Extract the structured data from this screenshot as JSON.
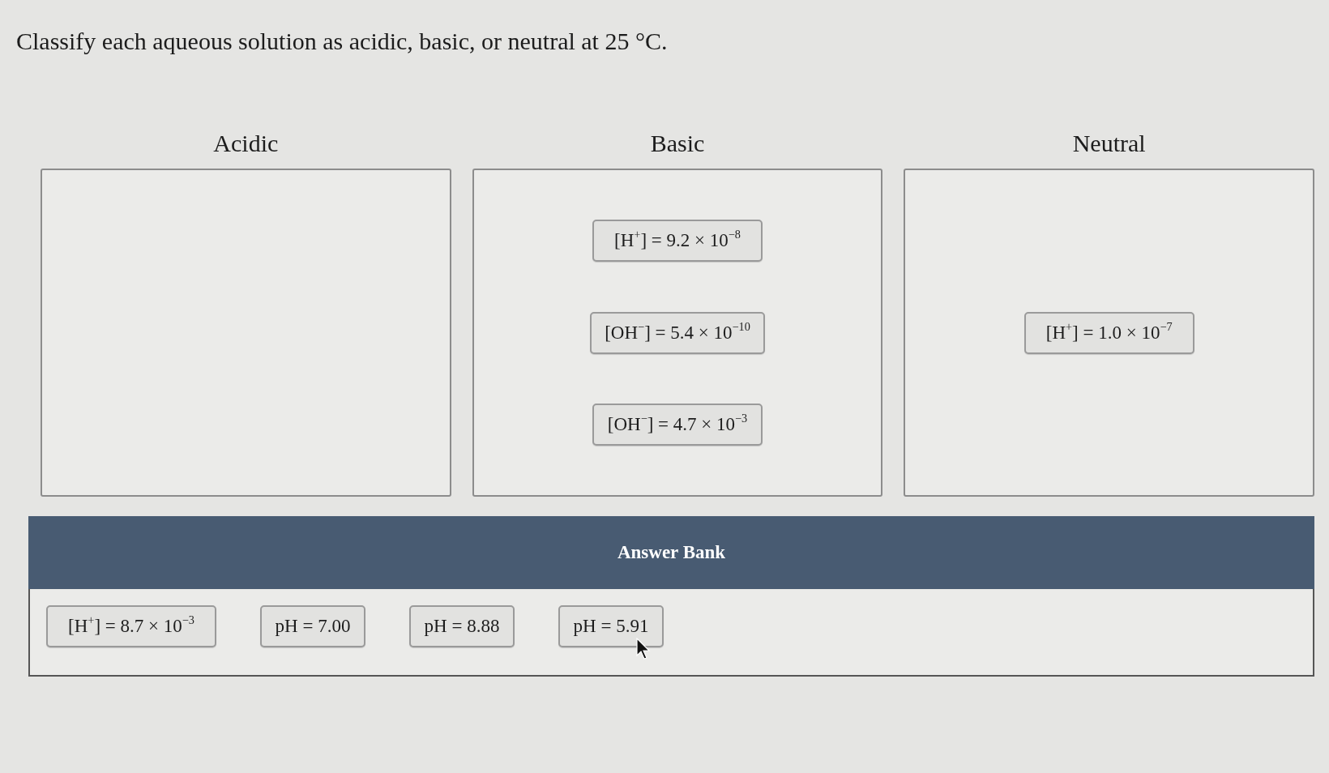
{
  "question": {
    "text": "Classify each aqueous solution as acidic, basic, or neutral at 25 °C."
  },
  "bins": [
    {
      "label": "Acidic"
    },
    {
      "label": "Basic",
      "items": [
        "[H$^{+}$] = 9.2 × 10$^{−8}$",
        "[OH$^{−}$] = 5.4 × 10$^{−10}$",
        "[OH$^{−}$] = 4.7 × 10$^{−3}$"
      ]
    },
    {
      "label": "Neutral",
      "items": [
        "[H$^{+}$] = 1.0 × 10$^{−7}$"
      ]
    }
  ],
  "answer_bank": {
    "title": "Answer Bank",
    "items": [
      "[H$^{+}$] = 8.7 × 10$^{−3}$",
      "pH = 7.00",
      "pH = 8.88",
      "pH = 5.91"
    ]
  }
}
